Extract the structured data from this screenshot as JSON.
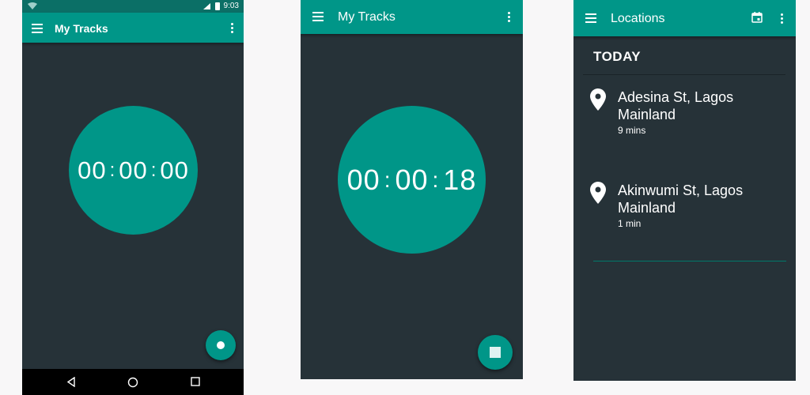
{
  "screen1": {
    "status": {
      "time": "9:03"
    },
    "toolbar": {
      "title": "My Tracks"
    },
    "timer": {
      "hours": "00",
      "minutes": "00",
      "seconds": "00",
      "separator": ":"
    }
  },
  "screen2": {
    "toolbar": {
      "title": "My Tracks"
    },
    "timer": {
      "hours": "00",
      "minutes": "00",
      "seconds": "18",
      "separator": ":"
    }
  },
  "screen3": {
    "toolbar": {
      "title": "Locations"
    },
    "section": "TODAY",
    "locations": [
      {
        "name": "Adesina St, Lagos Mainland",
        "duration": "9 mins"
      },
      {
        "name": "Akinwumi St, Lagos Mainland",
        "duration": "1 min"
      }
    ]
  },
  "colors": {
    "primary": "#009688",
    "background": "#263238",
    "status_bar": "#0b6f66",
    "page": "#f8f7f8"
  },
  "icons": [
    "wifi-icon",
    "signal-icon",
    "battery-icon",
    "menu-icon",
    "overflow-menu-icon",
    "record-icon",
    "stop-icon",
    "back-icon",
    "home-icon",
    "recents-icon",
    "calendar-icon",
    "location-pin-icon"
  ]
}
